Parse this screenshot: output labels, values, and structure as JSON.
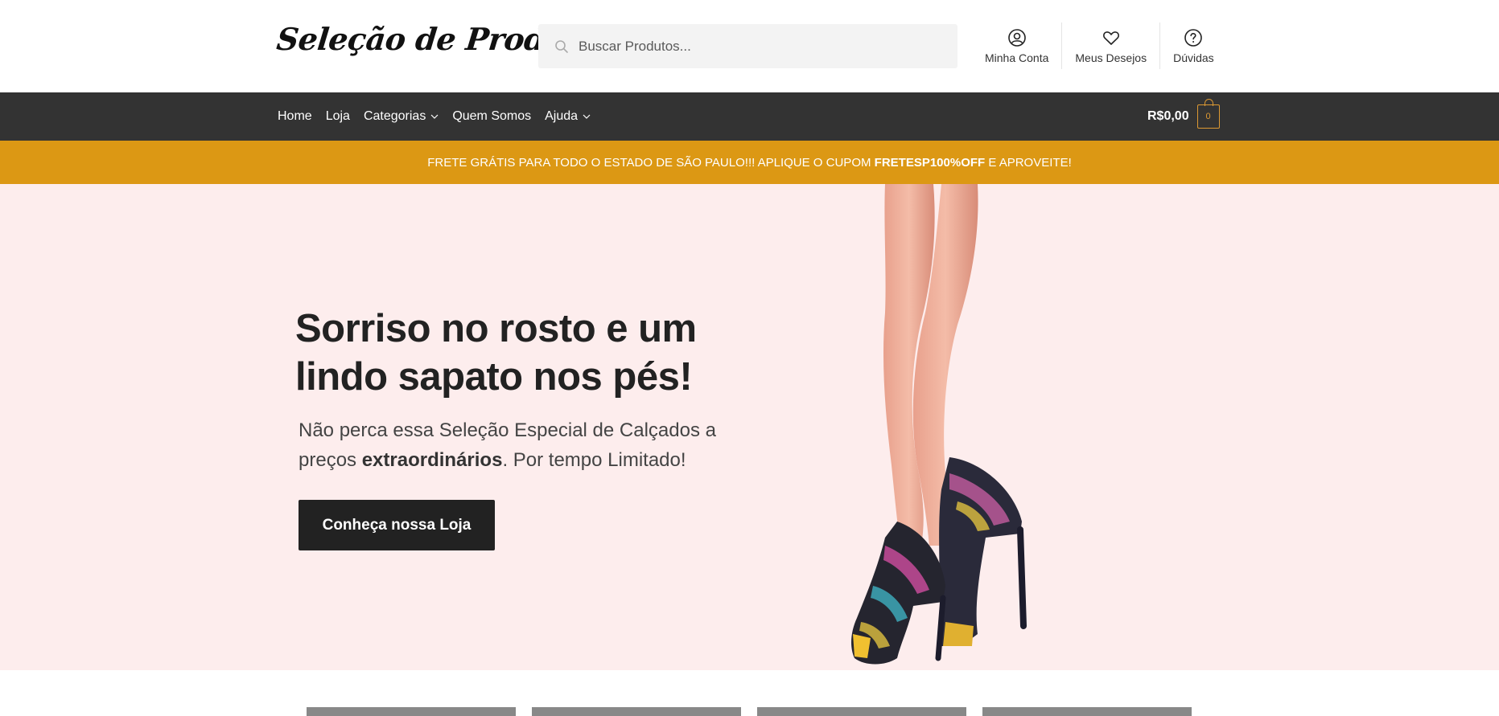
{
  "header": {
    "logo": "Seleção de Produtos",
    "search_placeholder": "Buscar Produtos...",
    "links": [
      {
        "label": "Minha Conta",
        "icon": "user-circle-icon"
      },
      {
        "label": "Meus Desejos",
        "icon": "heart-icon"
      },
      {
        "label": "Dúvidas",
        "icon": "question-circle-icon"
      }
    ]
  },
  "nav": {
    "items": [
      {
        "label": "Home"
      },
      {
        "label": "Loja"
      },
      {
        "label": "Categorias"
      },
      {
        "label": "Quem Somos"
      },
      {
        "label": "Ajuda"
      }
    ],
    "cart_total": "R$0,00",
    "cart_count": "0"
  },
  "promo": {
    "text_before": "FRETE GRÁTIS PARA TODO O ESTADO DE SÃO PAULO!!! APLIQUE O CUPOM ",
    "coupon": "FRETESP100%OFF",
    "text_after": " E APROVEITE!"
  },
  "hero": {
    "title": "Sorriso no rosto e um lindo sapato nos pés!",
    "subtitle_before": "Não perca essa Seleção Especial de Calçados a preços ",
    "subtitle_bold": "extraordinários",
    "subtitle_after": ". Por tempo Limitado!",
    "cta_label": "Conheça nossa Loja"
  },
  "colors": {
    "nav_bg": "#333333",
    "promo_bg": "#dc9814",
    "hero_bg": "#fdeded",
    "accent": "#dd9933",
    "cta_bg": "#222222"
  }
}
